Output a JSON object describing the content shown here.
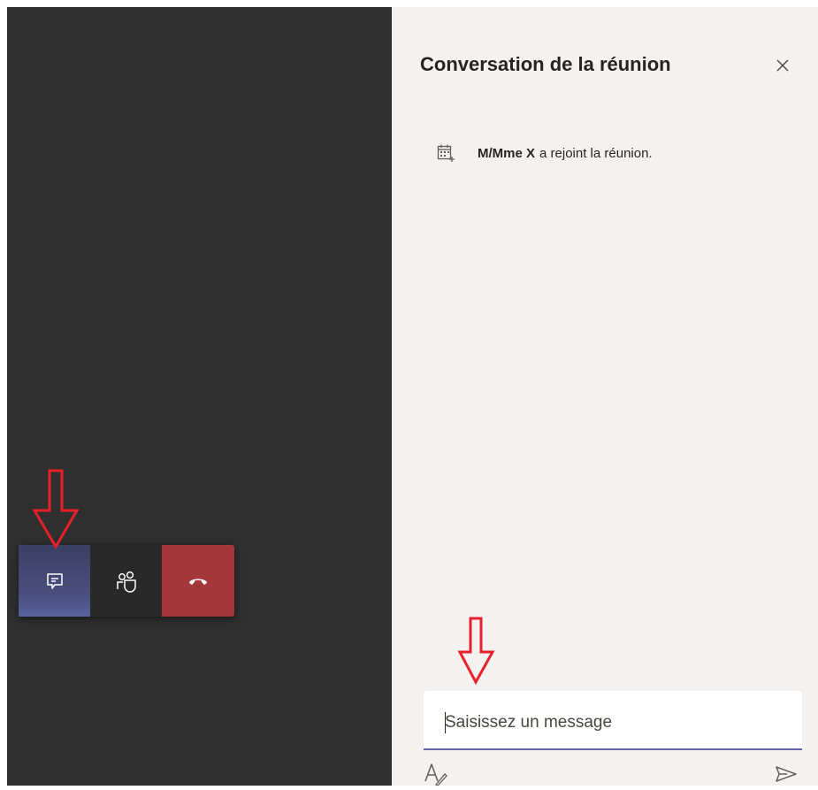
{
  "panel": {
    "title": "Conversation de la réunion"
  },
  "messages": [
    {
      "icon": "calendar-icon",
      "actor": "M/Mme X",
      "text": "a rejoint la réunion."
    }
  ],
  "compose": {
    "placeholder": "Saisissez un message"
  },
  "toolbar": {
    "buttons": [
      "chat-icon",
      "participants-icon",
      "hang-up-icon"
    ]
  },
  "colors": {
    "stage": "#2f2f2f",
    "panel": "#f3f2f1",
    "accent": "#6264a7",
    "hangup": "#a4373a",
    "annotation_arrow": "#e8202a"
  }
}
